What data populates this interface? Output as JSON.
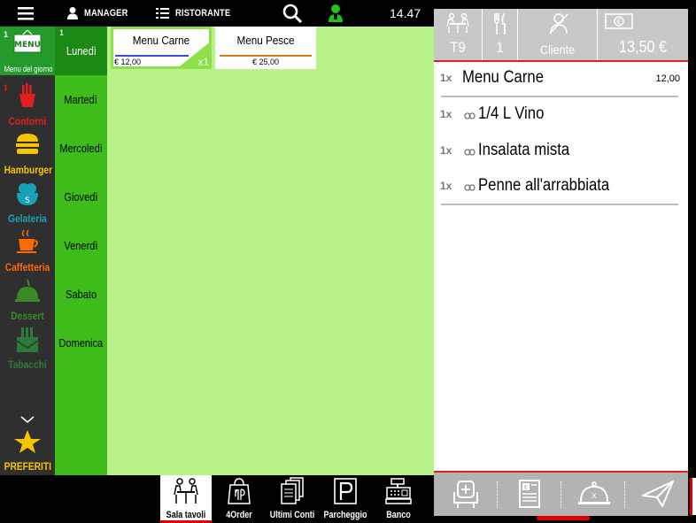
{
  "topbar": {
    "user": "MANAGER",
    "venue": "RISTORANTE",
    "clock": "14.47",
    "menu_icon": "hamburger-menu-icon",
    "search_icon": "search-icon",
    "operator_icon": "waiter-icon"
  },
  "categories": [
    {
      "label": "Menu del giorno",
      "badge": "1",
      "icon": "menu-board-icon",
      "color": "#ffffff",
      "active": true
    },
    {
      "label": "Contorni",
      "badge": "1",
      "icon": "fries-icon",
      "color": "#e02020"
    },
    {
      "label": "Hamburger",
      "badge": "",
      "icon": "burger-icon",
      "color": "#f2c500"
    },
    {
      "label": "Gelateria",
      "badge": "",
      "icon": "ice-cream-icon",
      "color": "#17a2b8"
    },
    {
      "label": "Caffetteria",
      "badge": "",
      "icon": "coffee-icon",
      "color": "#ff6a00"
    },
    {
      "label": "Dessert",
      "badge": "",
      "icon": "dessert-icon",
      "color": "#3a8a2a"
    },
    {
      "label": "Tabacchi",
      "badge": "",
      "icon": "tobacco-icon",
      "color": "#2f7a3a"
    },
    {
      "label": "PREFERITI",
      "badge": "",
      "icon": "star-icon",
      "color": "#f2c500"
    }
  ],
  "days": [
    {
      "label": "Lunedì",
      "badge": "1",
      "active": true
    },
    {
      "label": "Martedì",
      "badge": ""
    },
    {
      "label": "Mercoledì",
      "badge": ""
    },
    {
      "label": "Giovedì",
      "badge": ""
    },
    {
      "label": "Venerdì",
      "badge": ""
    },
    {
      "label": "Sabato",
      "badge": ""
    },
    {
      "label": "Domenica",
      "badge": ""
    }
  ],
  "products": [
    {
      "name": "Menu Carne",
      "price": "€ 12,00",
      "qty": "x1",
      "line_color": "#3a4fd6",
      "selected": true
    },
    {
      "name": "Menu Pesce",
      "price": "€ 25,00",
      "qty": "",
      "line_color": "#e07b1a",
      "selected": false
    }
  ],
  "bottomnav": [
    {
      "label": "Sala tavoli",
      "icon": "tables-icon",
      "active": true
    },
    {
      "label": "4Order",
      "icon": "shopping-bag-icon"
    },
    {
      "label": "Ultimi Conti",
      "icon": "receipts-icon"
    },
    {
      "label": "Parcheggio",
      "icon": "parking-icon"
    },
    {
      "label": "Banco",
      "icon": "cash-register-icon"
    }
  ],
  "order": {
    "table": "T9",
    "covers": "1",
    "customer": "Cliente",
    "total": "13,50 €",
    "lines": [
      {
        "qty": "1x",
        "name": "Menu Carne",
        "price": "12,00",
        "linked": false
      },
      {
        "qty": "1x",
        "name": "1/4 L Vino",
        "price": "",
        "linked": true
      },
      {
        "qty": "1x",
        "name": "Insalata mista",
        "price": "",
        "linked": true
      },
      {
        "qty": "1x",
        "name": "Penne all'arrabbiata",
        "price": "",
        "linked": true
      }
    ]
  },
  "actions": [
    {
      "name": "add-seat-icon"
    },
    {
      "name": "receipt-euro-icon"
    },
    {
      "name": "serve-cloche-icon"
    },
    {
      "name": "send-order-icon"
    }
  ]
}
